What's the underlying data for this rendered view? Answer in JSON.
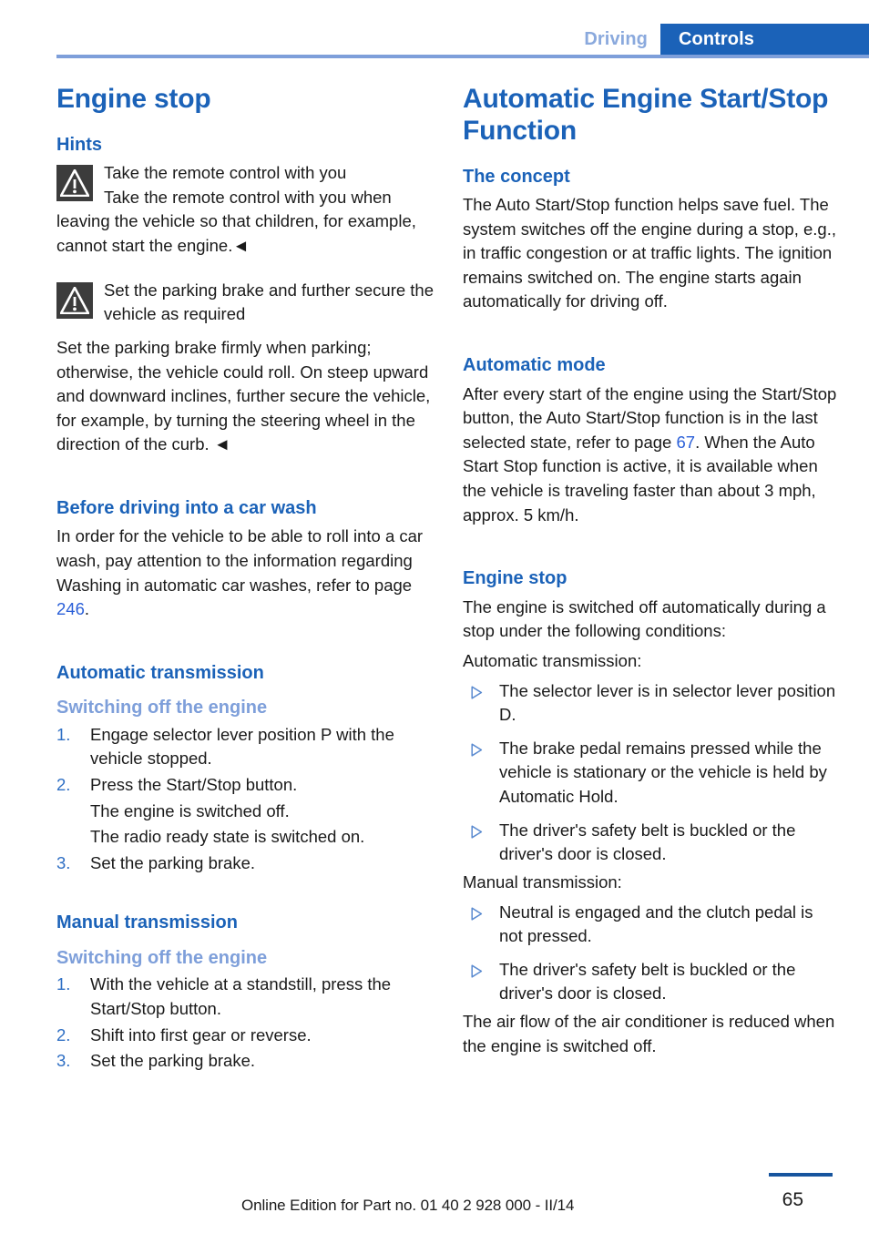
{
  "running_head": {
    "inactive_tab": "Driving",
    "active_tab": "Controls"
  },
  "colors": {
    "heading_blue": "#1b62b8",
    "subheading_blue": "#7e9fda",
    "link_blue": "#2a5fd8",
    "number_blue": "#2f6fc4",
    "rule_blue": "#7e9fda",
    "folio_rule_blue": "#17559e",
    "warning_icon_bg": "#3c3c3c",
    "body_text": "#1a1a1a"
  },
  "left_column": {
    "title": "Engine stop",
    "hints_heading": "Hints",
    "warning_1": {
      "icon": "warning-triangle-icon",
      "title": "Take the remote control with you",
      "text": "Take the remote control with you when leaving the vehicle so that children, for example, cannot start the engine.◄"
    },
    "warning_2": {
      "icon": "warning-triangle-icon",
      "title": "Set the parking brake and further secure the vehicle as required",
      "text": "Set the parking brake firmly when parking; otherwise, the vehicle could roll. On steep upward and downward inclines, further secure the vehicle, for example, by turning the steering wheel in the direction of the curb. ◄"
    },
    "car_wash": {
      "heading": "Before driving into a car wash",
      "text_before": "In order for the vehicle to be able to roll into a car wash, pay attention to the information regarding Washing in automatic car washes, refer to page ",
      "page_ref": "246",
      "text_after": "."
    },
    "automatic_transmission": {
      "heading": "Automatic transmission",
      "subheading": "Switching off the engine",
      "steps": [
        {
          "num": "1.",
          "text": "Engage selector lever position P with the vehicle stopped."
        },
        {
          "num": "2.",
          "text": "Press the Start/Stop button."
        }
      ],
      "notes": [
        "The engine is switched off.",
        "The radio ready state is switched on."
      ],
      "step_last": {
        "num": "3.",
        "text": "Set the parking brake."
      }
    },
    "manual_transmission": {
      "heading": "Manual transmission",
      "subheading": "Switching off the engine",
      "steps": [
        {
          "num": "1.",
          "text": "With the vehicle at a standstill, press the Start/Stop button."
        },
        {
          "num": "2.",
          "text": "Shift into first gear or reverse."
        },
        {
          "num": "3.",
          "text": "Set the parking brake."
        }
      ]
    }
  },
  "right_column": {
    "title": "Automatic Engine Start/Stop Function",
    "concept": {
      "heading": "The concept",
      "text": "The Auto Start/Stop function helps save fuel. The system switches off the engine during a stop, e.g., in traffic congestion or at traffic lights. The ignition remains switched on. The engine starts again automatically for driving off."
    },
    "automatic_mode": {
      "heading": "Automatic mode",
      "text_before": "After every start of the engine using the Start/Stop button, the Auto Start/Stop function is in the last selected state, refer to page ",
      "page_ref": "67",
      "text_after": ". When the Auto Start Stop function is active, it is available when the vehicle is traveling faster than about 3 mph, approx. 5 km/h."
    },
    "engine_stop": {
      "heading": "Engine stop",
      "intro": "The engine is switched off automatically during a stop under the following conditions:",
      "auto_label": "Automatic transmission:",
      "auto_bullets": [
        "The selector lever is in selector lever position D.",
        "The brake pedal remains pressed while the vehicle is stationary or the vehicle is held by Automatic Hold.",
        "The driver's safety belt is buckled or the driver's door is closed."
      ],
      "manual_label": "Manual transmission:",
      "manual_bullets": [
        "Neutral is engaged and the clutch pedal is not pressed.",
        "The driver's safety belt is buckled or the driver's door is closed."
      ],
      "closing": "The air flow of the air conditioner is reduced when the engine is switched off."
    }
  },
  "footer": {
    "edition": "Online Edition for Part no. 01 40 2 928 000 - II/14",
    "page_number": "65"
  }
}
